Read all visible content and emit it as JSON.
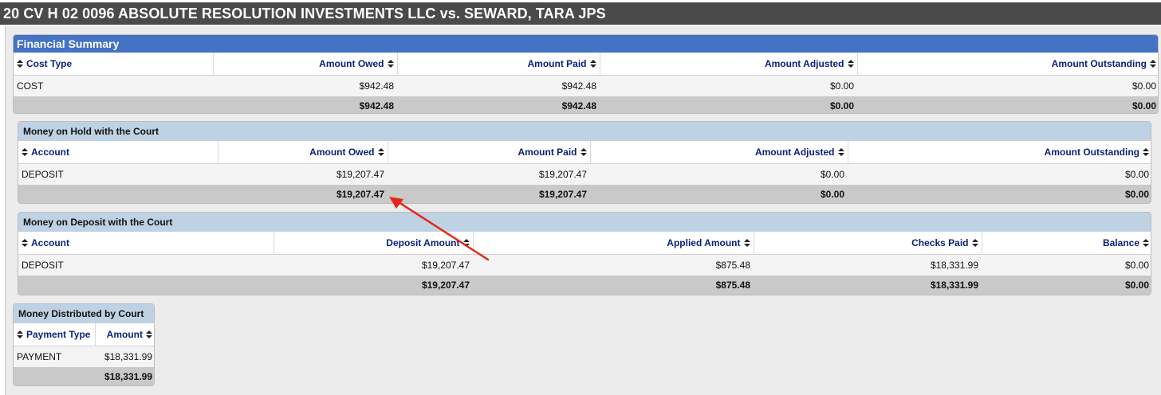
{
  "case": {
    "title": "20 CV H 02 0096 ABSOLUTE RESOLUTION INVESTMENTS LLC vs. SEWARD, TARA JPS"
  },
  "financial_summary": {
    "title": "Financial Summary",
    "headers": [
      "Cost Type",
      "Amount Owed",
      "Amount Paid",
      "Amount Adjusted",
      "Amount Outstanding"
    ],
    "rows": [
      [
        "COST",
        "$942.48",
        "$942.48",
        "$0.00",
        "$0.00"
      ]
    ],
    "total": [
      "",
      "$942.48",
      "$942.48",
      "$0.00",
      "$0.00"
    ]
  },
  "money_on_hold": {
    "title": "Money on Hold with the Court",
    "headers": [
      "Account",
      "Amount Owed",
      "Amount Paid",
      "Amount Adjusted",
      "Amount Outstanding"
    ],
    "rows": [
      [
        "DEPOSIT",
        "$19,207.47",
        "$19,207.47",
        "$0.00",
        "$0.00"
      ]
    ],
    "total": [
      "",
      "$19,207.47",
      "$19,207.47",
      "$0.00",
      "$0.00"
    ]
  },
  "money_on_deposit": {
    "title": "Money on Deposit with the Court",
    "headers": [
      "Account",
      "Deposit Amount",
      "Applied Amount",
      "Checks Paid",
      "Balance"
    ],
    "rows": [
      [
        "DEPOSIT",
        "$19,207.47",
        "$875.48",
        "$18,331.99",
        "$0.00"
      ]
    ],
    "total": [
      "",
      "$19,207.47",
      "$875.48",
      "$18,331.99",
      "$0.00"
    ]
  },
  "money_distributed": {
    "title": "Money Distributed by Court",
    "headers": [
      "Payment Type",
      "Amount"
    ],
    "rows": [
      [
        "PAYMENT",
        "$18,331.99"
      ]
    ],
    "total": [
      "",
      "$18,331.99"
    ]
  },
  "annotation": {
    "arrow_color": "#e8251a"
  },
  "colors": {
    "header_bar": "#4a4a4a",
    "summary_title": "#4472c4",
    "sub_title": "#bfd2e3",
    "header_text": "#0b1f7a"
  }
}
